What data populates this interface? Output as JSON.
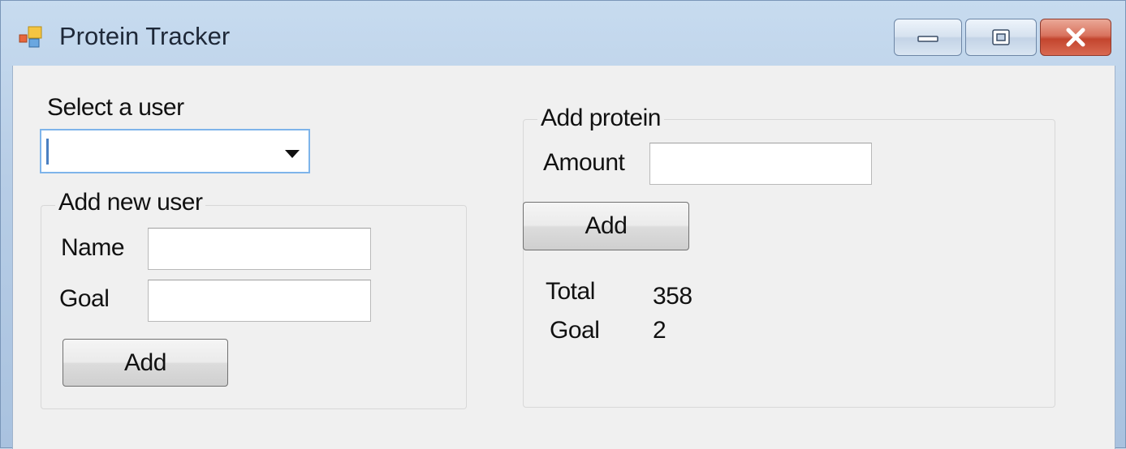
{
  "window": {
    "title": "Protein Tracker",
    "controls": {
      "minimize": "minimize-icon",
      "maximize": "maximize-icon",
      "close": "close-icon"
    }
  },
  "user_select": {
    "label": "Select a user",
    "value": ""
  },
  "new_user": {
    "group_title": "Add new user",
    "name_label": "Name",
    "name_value": "",
    "goal_label": "Goal",
    "goal_value": "",
    "add_label": "Add"
  },
  "protein": {
    "group_title": "Add protein",
    "amount_label": "Amount",
    "amount_value": "",
    "add_label": "Add",
    "total_label": "Total",
    "total_value": "358",
    "goal_label": "Goal",
    "goal_value": "2"
  }
}
